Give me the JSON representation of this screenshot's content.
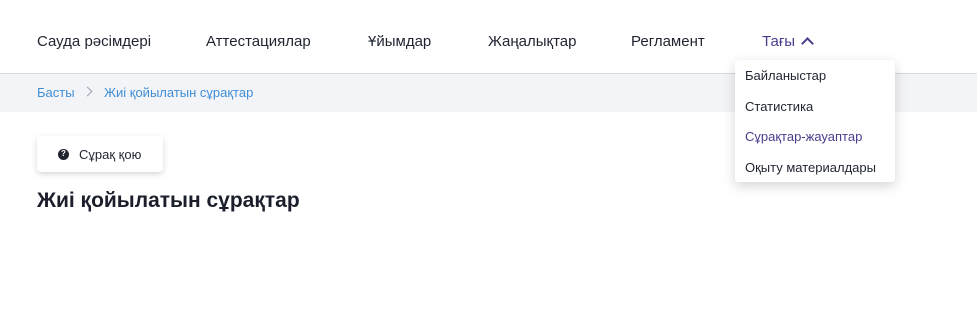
{
  "nav": {
    "items": [
      "Сауда рәсімдері",
      "Аттестациялар",
      "Ұйымдар",
      "Жаңалықтар",
      "Регламент"
    ],
    "more_label": "Тағы"
  },
  "dropdown": {
    "items": [
      "Байланыстар",
      "Статистика",
      "Сұрақтар-жауаптар",
      "Оқыту материалдары"
    ]
  },
  "breadcrumb": {
    "home": "Басты",
    "current": "Жиі қойылатын сұрақтар"
  },
  "ask_button": {
    "label": "Сұрақ қою",
    "icon": "question-circle-icon"
  },
  "page": {
    "title": "Жиі қойылатын сұрақтар"
  },
  "colors": {
    "accent": "#4a3d8c",
    "link": "#3f8ed6",
    "breadcrumb_bg": "#f3f4f7"
  }
}
